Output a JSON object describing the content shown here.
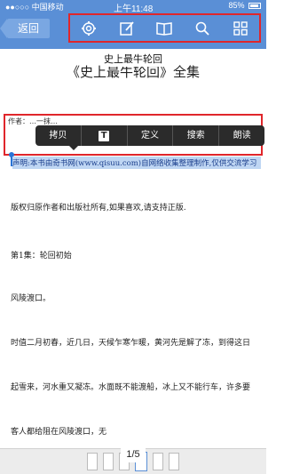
{
  "status_bar": {
    "carrier": "●●○○○ 中国移动",
    "time": "上午11:48",
    "battery_percent": "85%"
  },
  "nav": {
    "back_label": "返回"
  },
  "toolbar": {
    "icons": [
      "gear-icon",
      "edit-icon",
      "book-icon",
      "search-icon",
      "grid-icon"
    ]
  },
  "book": {
    "title": "《史上最牛轮回》全集",
    "tooltip_title": "史上最牛轮回",
    "author_line": "作者：…一抹…"
  },
  "context_menu": {
    "items": [
      "拷贝",
      "T",
      "定义",
      "搜索",
      "朗读"
    ]
  },
  "content": {
    "selected_text": "声明:本书由奇书网(www.qisuu.com)自网络收集整理制作,仅供交流学习",
    "paragraphs": [
      "版权归原作者和出版社所有,如果喜欢,请支持正版.",
      "第1集：轮回初始",
      "风陵渡口。",
      "时值二月初春，近几日，天候乍寒乍暖，黄河先是解了冻，到得这日",
      "起雪来，河水重又凝冻。水面既不能渡船，冰上又不能行车，许多要",
      "客人都给阻在风陵渡口，无"
    ]
  },
  "pagination": {
    "page_indicator": "1/5",
    "thumbnails": 6,
    "active_thumbnail": 3
  },
  "colors": {
    "topbar": "#5a8fd6",
    "highlight_box": "#e0262b",
    "selection": "#bfd6f3"
  }
}
